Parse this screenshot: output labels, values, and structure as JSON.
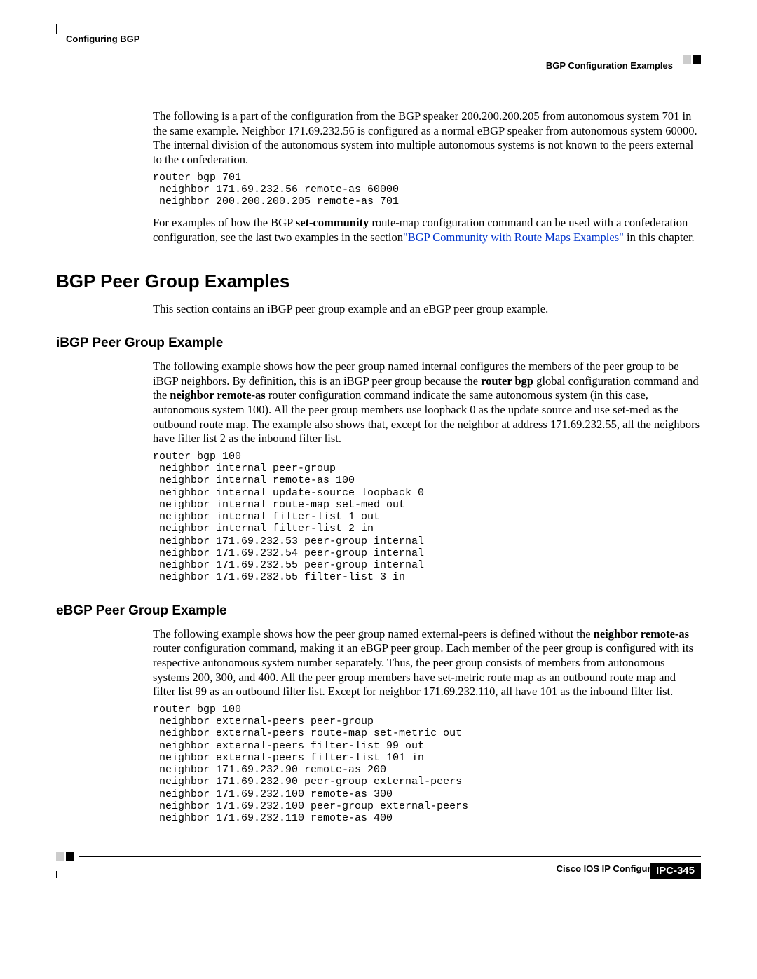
{
  "header": {
    "left": "Configuring BGP",
    "right": "BGP Configuration Examples"
  },
  "intro": {
    "para1": "The following is a part of the configuration from the BGP speaker 200.200.200.205 from autonomous system 701 in the same example. Neighbor 171.69.232.56 is configured as a normal eBGP speaker from autonomous system 60000. The internal division of the autonomous system into multiple autonomous systems is not known to the peers external to the confederation.",
    "code1": "router bgp 701\n neighbor 171.69.232.56 remote-as 60000\n neighbor 200.200.200.205 remote-as 701",
    "para2_part1": "For examples of how the BGP ",
    "para2_bold": "set-community",
    "para2_part2": " route-map configuration command can be used with a confederation configuration, see the last two examples in the section",
    "para2_link": "\"BGP Community with Route Maps Examples\"",
    "para2_part3": " in this chapter."
  },
  "h1": "BGP Peer Group Examples",
  "sec1_intro": "This section contains an iBGP peer group example and an eBGP peer group example.",
  "h2a": "iBGP Peer Group Example",
  "ibgp": {
    "para_part1": "The following example shows how the peer group named internal configures the members of the peer group to be iBGP neighbors. By definition, this is an iBGP peer group because the ",
    "para_bold1": "router bgp",
    "para_part2": " global configuration command and the ",
    "para_bold2": "neighbor remote-as",
    "para_part3": " router configuration command indicate the same autonomous system (in this case, autonomous system 100). All the peer group members use loopback 0 as the update source and use set-med as the outbound route map. The example also shows that, except for the neighbor at address 171.69.232.55, all the neighbors have filter list 2 as the inbound filter list.",
    "code": "router bgp 100\n neighbor internal peer-group\n neighbor internal remote-as 100\n neighbor internal update-source loopback 0\n neighbor internal route-map set-med out\n neighbor internal filter-list 1 out\n neighbor internal filter-list 2 in\n neighbor 171.69.232.53 peer-group internal\n neighbor 171.69.232.54 peer-group internal\n neighbor 171.69.232.55 peer-group internal\n neighbor 171.69.232.55 filter-list 3 in"
  },
  "h2b": "eBGP Peer Group Example",
  "ebgp": {
    "para_part1": "The following example shows how the peer group named external-peers is defined without the ",
    "para_bold1": "neighbor remote-as",
    "para_part2": " router configuration command, making it an eBGP peer group. Each member of the peer group is configured with its respective autonomous system number separately. Thus, the peer group consists of members from autonomous systems 200, 300, and 400. All the peer group members have set-metric route map as an outbound route map and filter list 99 as an outbound filter list. Except for neighbor 171.69.232.110, all have 101 as the inbound filter list.",
    "code": "router bgp 100\n neighbor external-peers peer-group\n neighbor external-peers route-map set-metric out\n neighbor external-peers filter-list 99 out\n neighbor external-peers filter-list 101 in\n neighbor 171.69.232.90 remote-as 200\n neighbor 171.69.232.90 peer-group external-peers\n neighbor 171.69.232.100 remote-as 300\n neighbor 171.69.232.100 peer-group external-peers\n neighbor 171.69.232.110 remote-as 400"
  },
  "footer": {
    "title": "Cisco IOS IP Configuration Guide",
    "page": "IPC-345"
  }
}
